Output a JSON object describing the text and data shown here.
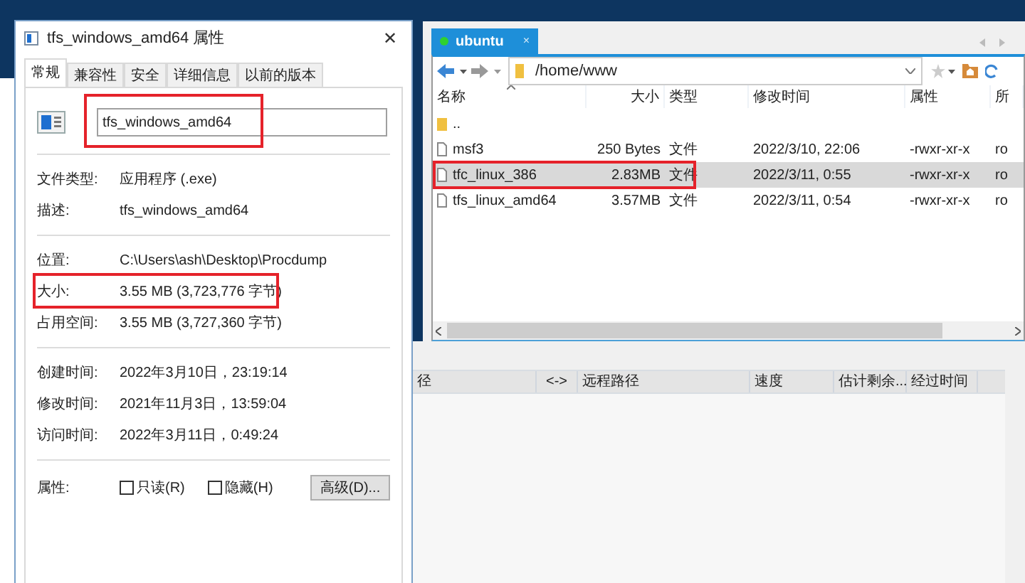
{
  "properties_dialog": {
    "title": "tfs_windows_amd64 属性",
    "close": "✕",
    "tabs": [
      {
        "label": "常规",
        "selected": true
      },
      {
        "label": "兼容性",
        "selected": false
      },
      {
        "label": "安全",
        "selected": false
      },
      {
        "label": "详细信息",
        "selected": false
      },
      {
        "label": "以前的版本",
        "selected": false
      }
    ],
    "file_name": {
      "value": "tfs_windows_amd64",
      "highlighted": true
    },
    "groups": [
      [
        {
          "label": "文件类型:",
          "value": "应用程序 (.exe)",
          "highlighted": false
        },
        {
          "label": "描述:",
          "value": "tfs_windows_amd64",
          "highlighted": false
        }
      ],
      [
        {
          "label": "位置:",
          "value": "C:\\Users\\ash\\Desktop\\Procdump",
          "highlighted": false
        },
        {
          "label": "大小:",
          "value": "3.55 MB (3,723,776 字节)",
          "highlighted": true
        },
        {
          "label": "占用空间:",
          "value": "3.55 MB (3,727,360 字节)",
          "highlighted": false
        }
      ],
      [
        {
          "label": "创建时间:",
          "value": "2022年3月10日，23:19:14",
          "highlighted": false
        },
        {
          "label": "修改时间:",
          "value": "2021年11月3日，13:59:04",
          "highlighted": false
        },
        {
          "label": "访问时间:",
          "value": "2022年3月11日，0:49:24",
          "highlighted": false
        }
      ]
    ],
    "attributes": {
      "label": "属性:",
      "checkboxes": [
        {
          "label": "只读(R)",
          "checked": false
        },
        {
          "label": "隐藏(H)",
          "checked": false
        }
      ],
      "advanced_button": "高级(D)..."
    }
  },
  "sftp_window": {
    "tabs": [
      {
        "label": "ubuntu",
        "selected": true,
        "connected": true,
        "close": "×"
      }
    ],
    "path": "/home/www",
    "columns": [
      "名称",
      "大小",
      "类型",
      "修改时间",
      "属性",
      "所"
    ],
    "rows": [
      {
        "kind": "folder",
        "name": "..",
        "size": "",
        "type": "",
        "modified": "",
        "permissions": "",
        "owner": "",
        "selected": false,
        "highlighted": false
      },
      {
        "kind": "file",
        "name": "msf3",
        "size": "250 Bytes",
        "type": "文件",
        "modified": "2022/3/10, 22:06",
        "permissions": "-rwxr-xr-x",
        "owner": "ro",
        "selected": false,
        "highlighted": false
      },
      {
        "kind": "file",
        "name": "tfc_linux_386",
        "size": "2.83MB",
        "type": "文件",
        "modified": "2022/3/11, 0:55",
        "permissions": "-rwxr-xr-x",
        "owner": "ro",
        "selected": true,
        "highlighted": true
      },
      {
        "kind": "file",
        "name": "tfs_linux_amd64",
        "size": "3.57MB",
        "type": "文件",
        "modified": "2022/3/11, 0:54",
        "permissions": "-rwxr-xr-x",
        "owner": "ro",
        "selected": false,
        "highlighted": false
      }
    ],
    "transfer_columns": [
      "径",
      "<->",
      "远程路径",
      "速度",
      "估计剩余...",
      "经过时间"
    ]
  }
}
